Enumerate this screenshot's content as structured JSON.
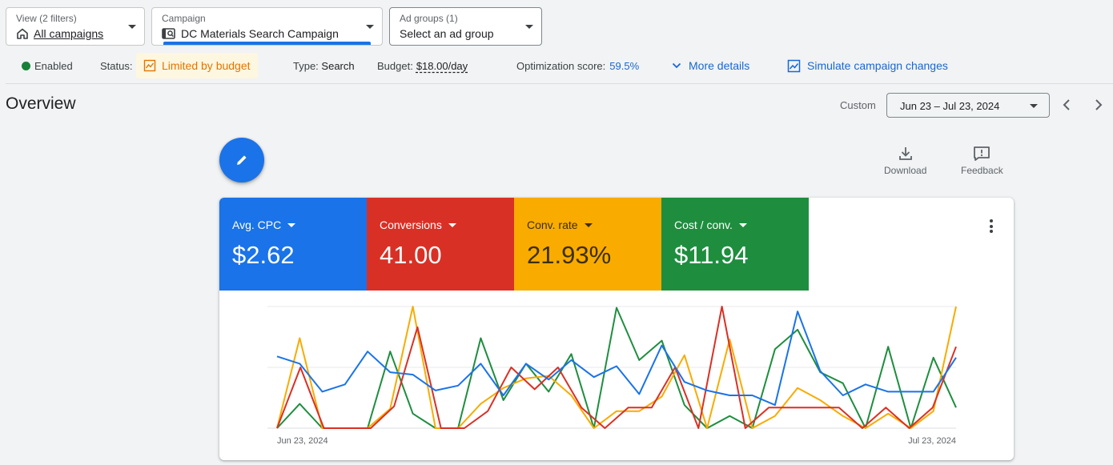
{
  "filters": {
    "view": {
      "caption": "View (2 filters)",
      "value": "All campaigns"
    },
    "campaign": {
      "caption": "Campaign",
      "value": "DC Materials Search Campaign"
    },
    "ad_group": {
      "caption": "Ad groups (1)",
      "value": "Select an ad group"
    }
  },
  "status_bar": {
    "enabled_label": "Enabled",
    "status_label": "Status:",
    "status_value": "Limited by budget",
    "type_label": "Type:",
    "type_value": "Search",
    "budget_label": "Budget:",
    "budget_value": "$18.00/day",
    "optimization_label": "Optimization score:",
    "optimization_value": "59.5%",
    "more_details": "More details",
    "simulate": "Simulate campaign changes"
  },
  "overview": {
    "title": "Overview",
    "custom_label": "Custom",
    "date_range": "Jun 23 – Jul 23, 2024"
  },
  "tools": {
    "download": "Download",
    "feedback": "Feedback"
  },
  "metrics": [
    {
      "label": "Avg. CPC",
      "value": "$2.62",
      "color": "#1a73e8"
    },
    {
      "label": "Conversions",
      "value": "41.00",
      "color": "#d93025"
    },
    {
      "label": "Conv. rate",
      "value": "21.93%",
      "color": "#f9ab00"
    },
    {
      "label": "Cost / conv.",
      "value": "$11.94",
      "color": "#1e8e3e"
    }
  ],
  "colors": {
    "blue": "#1a73e8",
    "red": "#d93025",
    "yellow": "#f9ab00",
    "green": "#1e8e3e",
    "orange_warning": "#e37400"
  },
  "chart_data": {
    "type": "line",
    "x_start_label": "Jun 23, 2024",
    "x_end_label": "Jul 23, 2024",
    "grid": true,
    "series": [
      {
        "name": "Avg. CPC",
        "color": "#1a73e8",
        "values": [
          0.59,
          0.53,
          0.3,
          0.36,
          0.63,
          0.46,
          0.44,
          0.31,
          0.35,
          0.53,
          0.27,
          0.53,
          0.4,
          0.56,
          0.42,
          0.51,
          0.28,
          0.68,
          0.38,
          0.31,
          0.27,
          0.27,
          0.19,
          0.96,
          0.47,
          0.27,
          0.36,
          0.3,
          0.3,
          0.3,
          0.58
        ]
      },
      {
        "name": "Conversions",
        "color": "#d93025",
        "values": [
          0,
          0.5,
          0,
          0,
          0,
          0.18,
          0.83,
          0,
          0,
          0.14,
          0.5,
          0.32,
          0.5,
          0.17,
          0,
          0.17,
          0.17,
          0.5,
          0,
          1,
          0,
          0.17,
          0.17,
          0.17,
          0.17,
          0,
          0.17,
          0,
          0.17,
          0.67
        ]
      },
      {
        "name": "Conv. rate",
        "color": "#f9ab00",
        "values": [
          0,
          0.74,
          0,
          0,
          0,
          0.16,
          1,
          0,
          0,
          0.2,
          0.33,
          0.41,
          0.43,
          0.27,
          0,
          0.14,
          0.14,
          0.26,
          0.6,
          0,
          0.73,
          0,
          0.1,
          0.33,
          0.23,
          0.1,
          0,
          0.12,
          0,
          0.14,
          1
        ]
      },
      {
        "name": "Cost / conv.",
        "color": "#1e8e3e",
        "values": [
          0,
          0.2,
          0,
          0,
          0,
          0.63,
          0.12,
          0,
          0,
          0.74,
          0.23,
          0.53,
          0.3,
          0.61,
          0,
          0.99,
          0.56,
          0.72,
          0.19,
          0,
          0.1,
          0,
          0.65,
          0.81,
          0.46,
          0.37,
          0,
          0.67,
          0,
          0.58,
          0.17
        ]
      }
    ]
  }
}
